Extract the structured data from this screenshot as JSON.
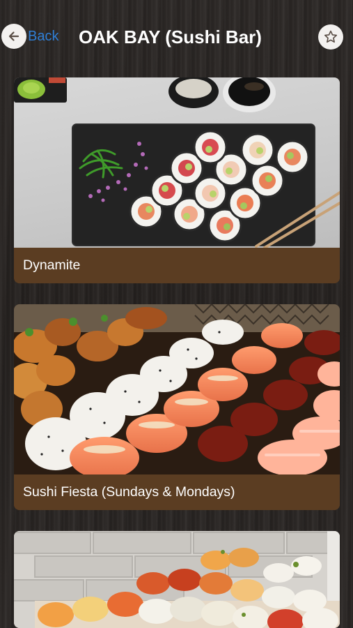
{
  "header": {
    "back_label": "Back",
    "title": "OAK BAY (Sushi Bar)",
    "back_icon": "arrow-left-icon",
    "favorite_icon": "star-outline-icon"
  },
  "colors": {
    "accent": "#2f7fd6",
    "caption_bar": "#5b3d22",
    "title_text": "#ffffff"
  },
  "menu_items": [
    {
      "label": "Dynamite"
    },
    {
      "label": "Sushi Fiesta (Sundays & Mondays)"
    },
    {
      "label": ""
    }
  ]
}
